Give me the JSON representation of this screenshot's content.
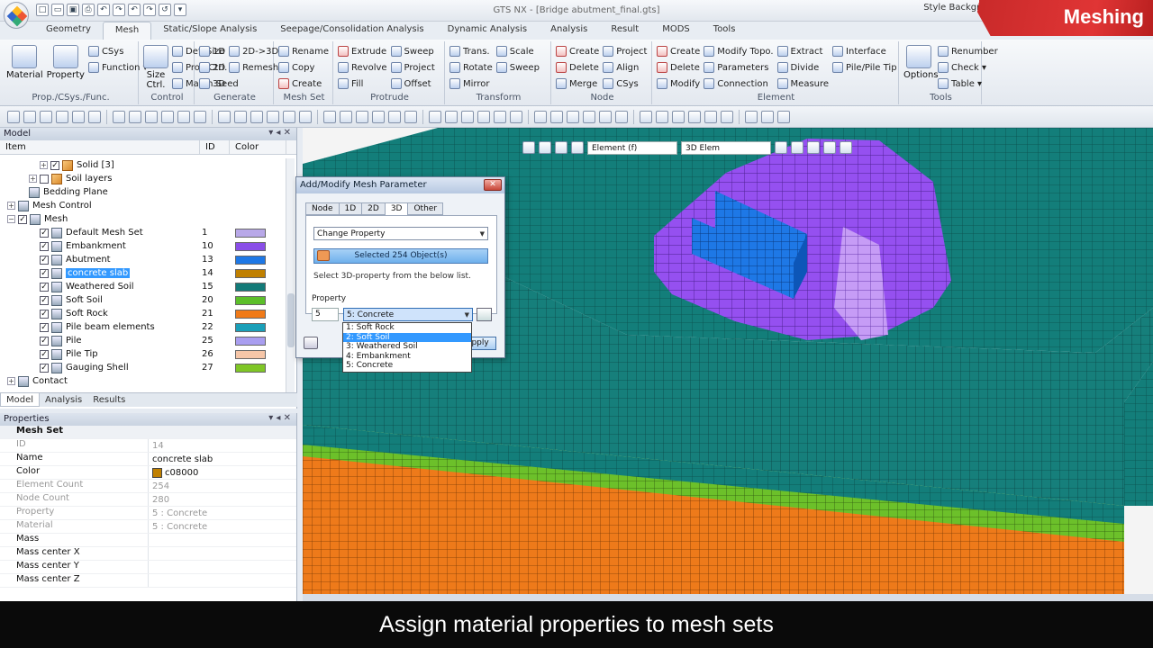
{
  "window": {
    "title": "GTS NX - [Bridge abutment_final.gts]",
    "brand": "Meshing"
  },
  "qat": [
    "□",
    "▭",
    "▣",
    "⎙",
    "↶",
    "↷",
    "↶",
    "↷",
    "↺",
    "▾"
  ],
  "menu_tabs": [
    "Geometry",
    "Mesh",
    "Static/Slope Analysis",
    "Seepage/Consolidation Analysis",
    "Dynamic Analysis",
    "Analysis",
    "Result",
    "MODS",
    "Tools"
  ],
  "menu_right": "Style    Backgrou...",
  "ribbon": {
    "groups": [
      {
        "label": "Prop./CSys./Func.",
        "big": [
          "Material",
          "Property"
        ],
        "items": [
          "CSys",
          "Function ▾"
        ]
      },
      {
        "label": "Control",
        "big": [
          "Size Ctrl."
        ],
        "items": [
          "Def. Size",
          "Prop Ctrl.",
          "Match Seed"
        ]
      },
      {
        "label": "Generate",
        "items": [
          "1D",
          "2D",
          "3D",
          "2D->3D",
          "Remesh"
        ]
      },
      {
        "label": "Mesh Set",
        "items": [
          "Rename",
          "Copy",
          "Create"
        ]
      },
      {
        "label": "Protrude",
        "items": [
          "Extrude",
          "Revolve",
          "Fill",
          "Sweep",
          "Project",
          "Offset"
        ]
      },
      {
        "label": "Transform",
        "items": [
          "Trans.",
          "Rotate",
          "Mirror",
          "Scale",
          "Sweep"
        ]
      },
      {
        "label": "Node",
        "items": [
          "Create",
          "Delete",
          "Merge",
          "Project",
          "Align",
          "CSys"
        ]
      },
      {
        "label": "Element",
        "items": [
          "Create",
          "Delete",
          "Modify",
          "Modify Topo.",
          "Parameters",
          "Connection",
          "Extract",
          "Divide",
          "Measure",
          "Interface",
          "Pile/Pile Tip"
        ]
      },
      {
        "label": "Tools",
        "big": [
          "Options"
        ],
        "items": [
          "Renumber",
          "Check ▾",
          "Table ▾"
        ]
      }
    ]
  },
  "model_panel": {
    "title": "Model",
    "columns": [
      "Item",
      "ID",
      "Color"
    ],
    "rows": [
      {
        "indent": 3,
        "exp": "+",
        "chk": "☑",
        "label": "Solid [3]",
        "id": "",
        "color": "",
        "icon": "cube"
      },
      {
        "indent": 2,
        "exp": "+",
        "chk": "☐",
        "label": "Soil layers",
        "id": "",
        "color": "",
        "icon": "cube"
      },
      {
        "indent": 1,
        "exp": "",
        "chk": "",
        "label": "Bedding Plane",
        "id": "",
        "color": "",
        "icon": "plane"
      },
      {
        "indent": 0,
        "exp": "+",
        "chk": "",
        "label": "Mesh Control",
        "id": "",
        "color": "",
        "icon": "ctrl"
      },
      {
        "indent": 0,
        "exp": "−",
        "chk": "☑",
        "label": "Mesh",
        "id": "",
        "color": "",
        "icon": "mesh"
      },
      {
        "indent": 2,
        "exp": "",
        "chk": "☑",
        "label": "Default Mesh Set",
        "id": "1",
        "color": "#b8a8e8",
        "icon": "mesh"
      },
      {
        "indent": 2,
        "exp": "",
        "chk": "☑",
        "label": "Embankment",
        "id": "10",
        "color": "#8a4ee8",
        "icon": "mesh"
      },
      {
        "indent": 2,
        "exp": "",
        "chk": "☑",
        "label": "Abutment",
        "id": "13",
        "color": "#1e78e6",
        "icon": "mesh"
      },
      {
        "indent": 2,
        "exp": "",
        "chk": "☑",
        "label": "concrete slab",
        "id": "14",
        "color": "#c08000",
        "icon": "mesh",
        "selected": true
      },
      {
        "indent": 2,
        "exp": "",
        "chk": "☑",
        "label": "Weathered Soil",
        "id": "15",
        "color": "#127a78",
        "icon": "mesh"
      },
      {
        "indent": 2,
        "exp": "",
        "chk": "☑",
        "label": "Soft Soil",
        "id": "20",
        "color": "#5cbf2a",
        "icon": "mesh"
      },
      {
        "indent": 2,
        "exp": "",
        "chk": "☑",
        "label": "Soft Rock",
        "id": "21",
        "color": "#f07a18",
        "icon": "mesh"
      },
      {
        "indent": 2,
        "exp": "",
        "chk": "☑",
        "label": "Pile beam elements",
        "id": "22",
        "color": "#1a9fb8",
        "icon": "mesh"
      },
      {
        "indent": 2,
        "exp": "",
        "chk": "☑",
        "label": "Pile",
        "id": "25",
        "color": "#a99ef0",
        "icon": "mesh"
      },
      {
        "indent": 2,
        "exp": "",
        "chk": "☑",
        "label": "Pile Tip",
        "id": "26",
        "color": "#f6c6a8",
        "icon": "mesh"
      },
      {
        "indent": 2,
        "exp": "",
        "chk": "☑",
        "label": "Gauging Shell",
        "id": "27",
        "color": "#7fc626",
        "icon": "mesh"
      },
      {
        "indent": 0,
        "exp": "+",
        "chk": "",
        "label": "Contact",
        "id": "",
        "color": "",
        "icon": "contact"
      }
    ]
  },
  "model_tabs": [
    "Model",
    "Analysis",
    "Results"
  ],
  "properties": {
    "title": "Properties",
    "category": "Mesh Set",
    "rows": [
      {
        "k": "ID",
        "v": "14",
        "dis": true
      },
      {
        "k": "Name",
        "v": "concrete slab",
        "dis": false
      },
      {
        "k": "Color",
        "v": "c08000",
        "dis": false,
        "swatch": "#c08000"
      },
      {
        "k": "Element Count",
        "v": "254",
        "dis": true
      },
      {
        "k": "Node Count",
        "v": "280",
        "dis": true
      },
      {
        "k": "Property",
        "v": "5 : Concrete",
        "dis": true
      },
      {
        "k": "Material",
        "v": "5 : Concrete",
        "dis": true
      },
      {
        "k": "Mass",
        "v": "",
        "dis": false
      },
      {
        "k": "Mass center X",
        "v": "",
        "dis": false
      },
      {
        "k": "Mass center Y",
        "v": "",
        "dis": false
      },
      {
        "k": "Mass center Z",
        "v": "",
        "dis": false
      }
    ]
  },
  "viewport_toolbar": {
    "filter": "Element (f)",
    "elem": "3D Elem"
  },
  "dialog": {
    "title": "Add/Modify Mesh Parameter",
    "tabs": [
      "Node",
      "1D",
      "2D",
      "3D",
      "Other"
    ],
    "mode": "Change Property",
    "selected": "Selected 254 Object(s)",
    "hint": "Select 3D-property from the below list.",
    "property_label": "Property",
    "property_id": "5",
    "property_value": "5: Concrete",
    "apply": "Apply",
    "options": [
      "1: Soft Rock",
      "2: Soft Soil",
      "3: Weathered Soil",
      "4: Embankment",
      "5: Concrete"
    ],
    "highlighted": 1
  },
  "caption": "Assign material properties to mesh sets",
  "colors": {
    "teal": "#137e7a",
    "green": "#6cc02a",
    "orange": "#ee7a1a",
    "purple": "#9550f0",
    "blue": "#1e78e6",
    "accent": "#e03535"
  }
}
